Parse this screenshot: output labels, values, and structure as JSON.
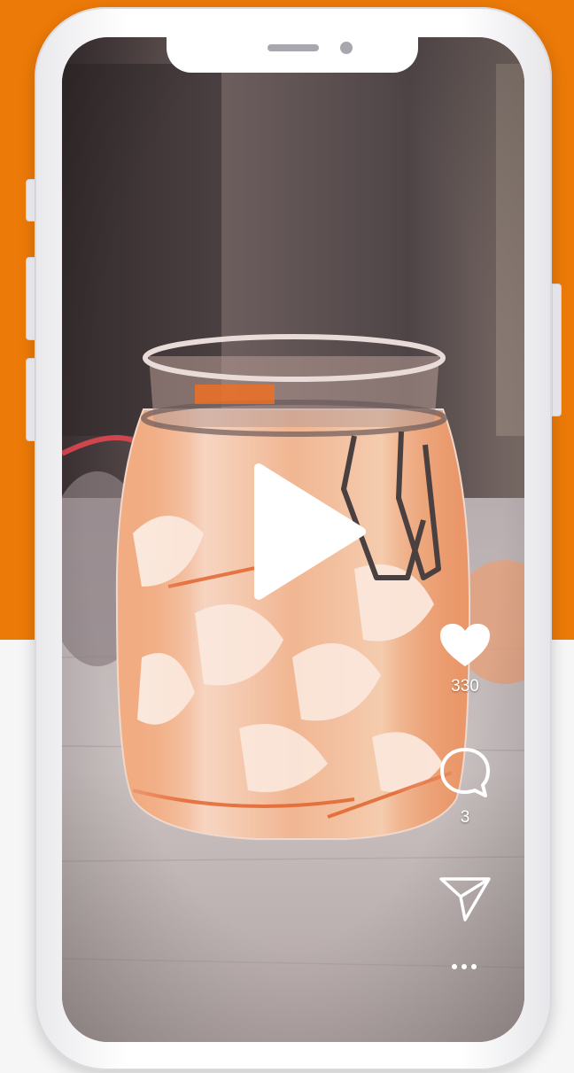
{
  "video": {
    "description_icon": "play-icon"
  },
  "actions": {
    "like": {
      "icon": "heart-icon",
      "count": "330"
    },
    "comment": {
      "icon": "comment-bubble-icon",
      "count": "3"
    },
    "share": {
      "icon": "paper-plane-icon"
    },
    "more": {
      "icon": "more-dots-icon"
    }
  },
  "colors": {
    "brand_orange": "#ec7a08",
    "page_light": "#f6f6f6",
    "phone_frame": "#ffffff"
  }
}
